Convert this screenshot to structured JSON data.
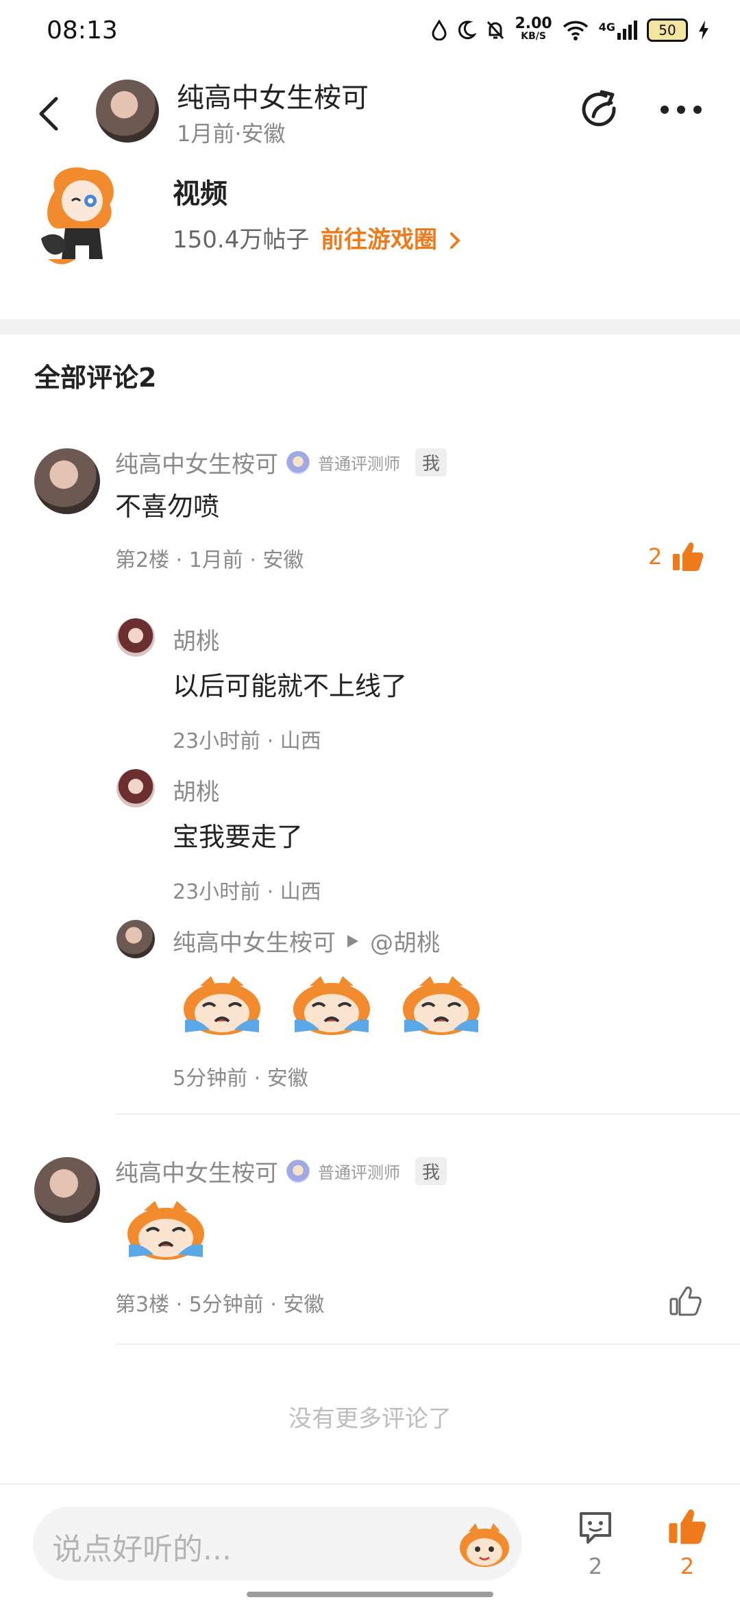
{
  "status_bar": {
    "time": "08:13",
    "net_speed_value": "2.00",
    "net_speed_unit": "KB/S",
    "network": "4G",
    "battery": "50",
    "icons": [
      "drop-icon",
      "moon-icon",
      "bell-off-icon",
      "wifi-icon",
      "signal-icon",
      "battery-icon",
      "charging-icon"
    ]
  },
  "header": {
    "author": "纯高中女生桉可",
    "meta": "1月前·安徽"
  },
  "game": {
    "title": "视频",
    "posts": "150.4万帖子",
    "link_label": "前往游戏圈"
  },
  "comments_header": "全部评论2",
  "comments": [
    {
      "name": "纯高中女生桉可",
      "badge": "普通评测师",
      "me_tag": "我",
      "body": "不喜勿喷",
      "meta": "第2楼 · 1月前 · 安徽",
      "likes": "2",
      "replies": [
        {
          "name": "胡桃",
          "body": "以后可能就不上线了",
          "meta": "23小时前 · 山西"
        },
        {
          "name": "胡桃",
          "body": "宝我要走了",
          "meta": "23小时前 · 山西"
        },
        {
          "name": "纯高中女生桉可",
          "reply_to": "@胡桃",
          "meta": "5分钟前 · 安徽"
        }
      ]
    },
    {
      "name": "纯高中女生桉可",
      "badge": "普通评测师",
      "me_tag": "我",
      "meta": "第3楼 · 5分钟前 · 安徽"
    }
  ],
  "no_more": "没有更多评论了",
  "bottom_bar": {
    "placeholder": "说点好听的...",
    "comment_count": "2",
    "like_count": "2"
  },
  "colors": {
    "accent": "#ee7a1c",
    "muted": "#8a8a8a"
  }
}
